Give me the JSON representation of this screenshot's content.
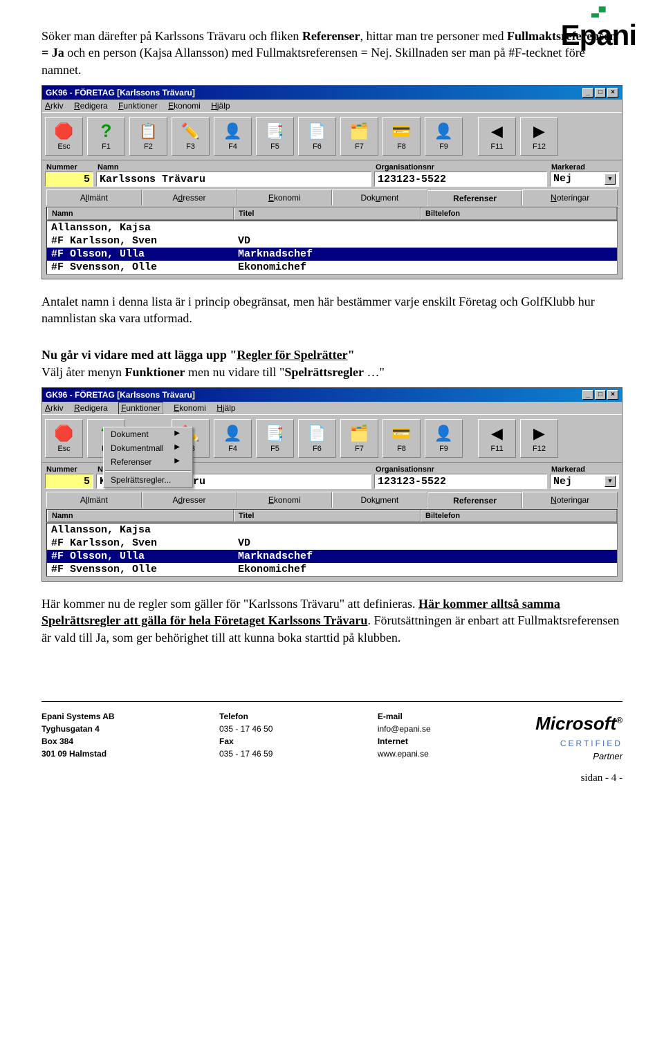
{
  "logo": {
    "mark": "▚",
    "name": "Epani"
  },
  "intro": {
    "p1a": "Söker man därefter på Karlssons Trävaru och fliken ",
    "p1b": "Referenser",
    "p1c": ", hittar man tre personer med ",
    "p1d": "Fullmaktsreferensen = Ja",
    "p1e": " och en person (Kajsa Allansson) med Fullmaktsreferensen = Nej. Skillnaden ser man på #F-tecknet före namnet."
  },
  "app1": {
    "title": "GK96 - FÖRETAG [Karlssons Trävaru]",
    "menu": [
      "Arkiv",
      "Redigera",
      "Funktioner",
      "Ekonomi",
      "Hjälp"
    ],
    "tbtns": [
      "Esc",
      "F1",
      "F2",
      "F3",
      "F4",
      "F5",
      "F6",
      "F7",
      "F8",
      "F9",
      "F11",
      "F12"
    ],
    "nummer_lbl": "Nummer",
    "nummer": "5",
    "namn_lbl": "Namn",
    "namn": "Karlssons Trävaru",
    "org_lbl": "Organisationsnr",
    "org": "123123-5522",
    "mark_lbl": "Markerad",
    "mark": "Nej",
    "tabs": [
      "Allmänt",
      "Adresser",
      "Ekonomi",
      "Dokument",
      "Referenser",
      "Noteringar"
    ],
    "cols": [
      "Namn",
      "Titel",
      "Biltelefon"
    ],
    "rows": [
      {
        "n": "Allansson, Kajsa",
        "t": "",
        "sel": false
      },
      {
        "n": "#F Karlsson, Sven",
        "t": "VD",
        "sel": false
      },
      {
        "n": "#F Olsson, Ulla",
        "t": "Marknadschef",
        "sel": true
      },
      {
        "n": "#F Svensson, Olle",
        "t": "Ekonomichef",
        "sel": false
      }
    ]
  },
  "mid1": "Antalet namn i denna lista är i princip obegränsat, men här bestämmer varje enskilt Företag och GolfKlubb hur namnlistan ska vara utformad.",
  "mid2a": "Nu går vi vidare med att lägga upp \"",
  "mid2b": "Regler för Spelrätter",
  "mid2c": "\"",
  "mid3a": "Välj åter menyn ",
  "mid3b": "Funktioner",
  "mid3c": " men nu vidare till \"",
  "mid3d": "Spelrättsregler",
  "mid3e": " …\"",
  "dropdown": {
    "items": [
      "Dokument",
      "Dokumentmall",
      "Referenser"
    ],
    "last": "Spelrättsregler..."
  },
  "end": {
    "p1a": "Här kommer nu de regler som gäller för \"Karlssons Trävaru\" att definieras. ",
    "p1b": "Här kommer alltså samma Spelrättsregler att gälla för hela Företaget Karlssons Trävaru",
    "p1c": ". Förutsättningen är enbart att Fullmaktsreferensen är vald till Ja, som ger behörighet till att kunna boka starttid på klubben."
  },
  "footer": {
    "company": "Epani Systems AB",
    "addr1": "Tyghusgatan 4",
    "addr2": "Box 384",
    "addr3": "301 09  Halmstad",
    "tel_lbl": "Telefon",
    "tel": "035 - 17 46 50",
    "fax_lbl": "Fax",
    "fax": "035 - 17 46 59",
    "email_lbl": "E-mail",
    "email": "info@epani.se",
    "net_lbl": "Internet",
    "net": "www.epani.se",
    "ms": "Microsoft",
    "cert": "CERTIFIED",
    "part": "Partner"
  },
  "page": "sidan - 4 -"
}
